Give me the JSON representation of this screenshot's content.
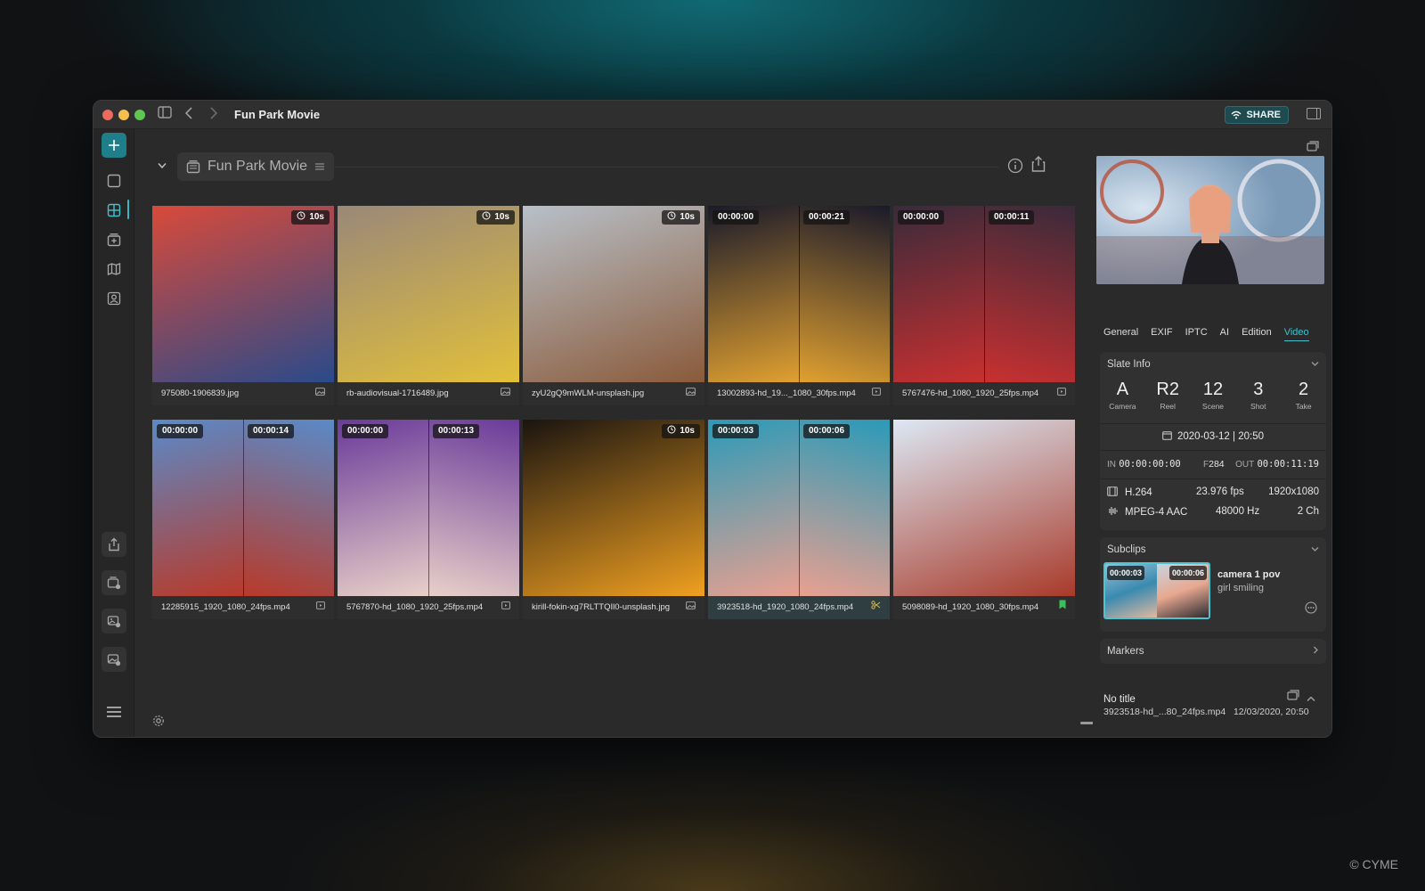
{
  "window": {
    "title": "Fun Park Movie",
    "share_label": "SHARE"
  },
  "collection": {
    "name": "Fun Park Movie"
  },
  "grid": {
    "items": [
      {
        "filename": "975080-1906839.jpg",
        "badge_left": "",
        "badge_right": "10s",
        "type_icon": "image",
        "colors": [
          "#d84a3a",
          "#2a4a8a"
        ]
      },
      {
        "filename": "rb-audiovisual-1716489.jpg",
        "badge_left": "",
        "badge_right": "10s",
        "type_icon": "image",
        "colors": [
          "#9a8878",
          "#e2c03a"
        ]
      },
      {
        "filename": "zyU2gQ9mWLM-unsplash.jpg",
        "badge_left": "",
        "badge_right": "10s",
        "type_icon": "image",
        "colors": [
          "#b8c0c8",
          "#8a5a3a"
        ]
      },
      {
        "filename": "13002893-hd_19..._1080_30fps.mp4",
        "badge_left": "00:00:00",
        "badge_right": "00:00:21",
        "type_icon": "video",
        "colors": [
          "#1a1a2a",
          "#e0a030"
        ]
      },
      {
        "filename": "5767476-hd_1080_1920_25fps.mp4",
        "badge_left": "00:00:00",
        "badge_right": "00:00:11",
        "type_icon": "video",
        "colors": [
          "#3a2a3a",
          "#c83030"
        ]
      },
      {
        "filename": "12285915_1920_1080_24fps.mp4",
        "badge_left": "00:00:00",
        "badge_right": "00:00:14",
        "type_icon": "video",
        "colors": [
          "#5a8ac8",
          "#b83a2a"
        ]
      },
      {
        "filename": "5767870-hd_1080_1920_25fps.mp4",
        "badge_left": "00:00:00",
        "badge_right": "00:00:13",
        "type_icon": "video",
        "colors": [
          "#6a3a9a",
          "#e8d0c8"
        ]
      },
      {
        "filename": "kirill-fokin-xg7RLTTQIl0-unsplash.jpg",
        "badge_left": "",
        "badge_right": "10s",
        "type_icon": "image",
        "colors": [
          "#1a1410",
          "#f0a020"
        ]
      },
      {
        "filename": "3923518-hd_1920_1080_24fps.mp4",
        "badge_left": "00:00:03",
        "badge_right": "00:00:06",
        "type_icon": "scissors",
        "colors": [
          "#2a9ab8",
          "#e8a090"
        ],
        "selected": true
      },
      {
        "filename": "5098089-hd_1920_1080_30fps.mp4",
        "badge_left": "",
        "badge_right": "",
        "type_icon": "bookmark",
        "colors": [
          "#dce8f4",
          "#a83a2a"
        ]
      }
    ]
  },
  "inspector": {
    "tabs": [
      "General",
      "EXIF",
      "IPTC",
      "AI",
      "Edition",
      "Video"
    ],
    "active_tab": "Video",
    "slate": {
      "title": "Slate Info",
      "items": [
        {
          "value": "A",
          "label": "Camera"
        },
        {
          "value": "R2",
          "label": "Reel"
        },
        {
          "value": "12",
          "label": "Scene"
        },
        {
          "value": "3",
          "label": "Shot"
        },
        {
          "value": "2",
          "label": "Take"
        }
      ],
      "datetime": "2020-03-12 | 20:50",
      "in_label": "IN",
      "in_value": "00:00:00:00",
      "f_label": "F",
      "f_value": "284",
      "out_label": "OUT",
      "out_value": "00:00:11:19",
      "video_codec": "H.264",
      "fps": "23.976 fps",
      "resolution": "1920x1080",
      "audio_codec": "MPEG-4 AAC",
      "sample_rate": "48000 Hz",
      "channels": "2 Ch"
    },
    "subclips": {
      "title": "Subclips",
      "clip_in": "00:00:03",
      "clip_out": "00:00:06",
      "name": "camera 1 pov",
      "description": "girl smiling"
    },
    "markers": {
      "title": "Markers"
    },
    "footer": {
      "title": "No title",
      "filename": "3923518-hd_...80_24fps.mp4",
      "date": "12/03/2020, 20:50"
    }
  },
  "zoom": {
    "level": 0.5
  },
  "copyright": "© CYME"
}
